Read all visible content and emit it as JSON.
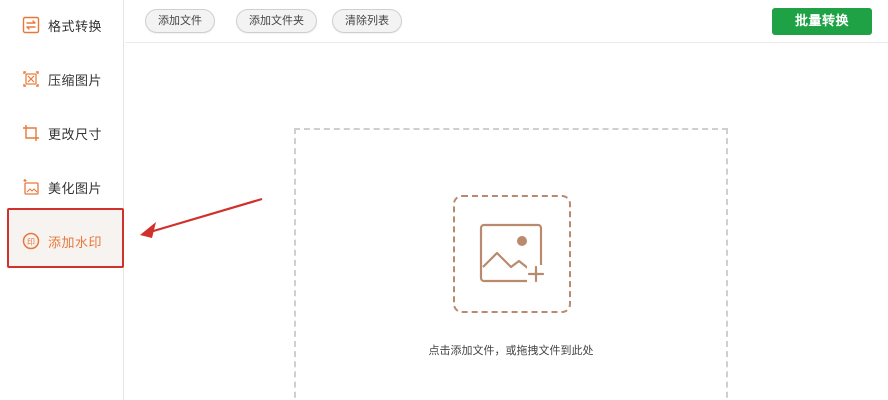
{
  "sidebar": {
    "items": [
      {
        "label": "格式转换",
        "icon": "convert-icon"
      },
      {
        "label": "压缩图片",
        "icon": "compress-icon"
      },
      {
        "label": "更改尺寸",
        "icon": "resize-icon"
      },
      {
        "label": "美化图片",
        "icon": "beautify-icon"
      },
      {
        "label": "添加水印",
        "icon": "watermark-icon",
        "active": true
      }
    ]
  },
  "toolbar": {
    "add_file": "添加文件",
    "add_folder": "添加文件夹",
    "clear_list": "清除列表",
    "batch_convert": "批量转换"
  },
  "dropzone": {
    "hint": "点击添加文件，或拖拽文件到此处",
    "icon": "add-image-icon"
  },
  "colors": {
    "accent": "#e8783a",
    "primary": "#1fa246",
    "highlight": "#d0312d",
    "dropzone_icon": "#b98a6e"
  }
}
